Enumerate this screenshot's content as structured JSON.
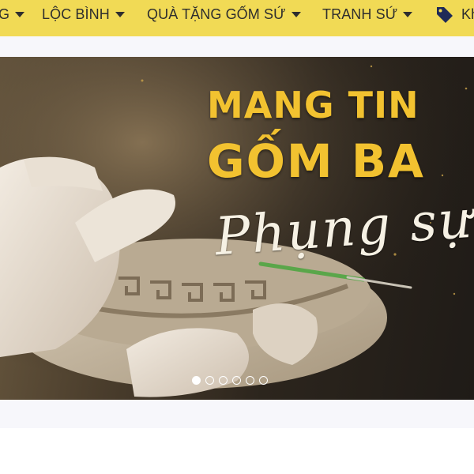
{
  "nav": {
    "items": [
      {
        "label": "G",
        "has_dropdown": true
      },
      {
        "label": "LỘC BÌNH",
        "has_dropdown": true
      },
      {
        "label": "QUÀ TẶNG GỐM SỨ",
        "has_dropdown": true
      },
      {
        "label": "TRANH SỨ",
        "has_dropdown": true
      },
      {
        "label": "Kh",
        "icon": "tag-icon"
      }
    ],
    "background": "#f1da55"
  },
  "banner": {
    "headline_line1": "MANG TIN",
    "headline_line2": "GỐM BA",
    "script_text": "Phụng sự",
    "headline_color": "#f2c230",
    "slides_total": 6,
    "active_slide": 1
  }
}
